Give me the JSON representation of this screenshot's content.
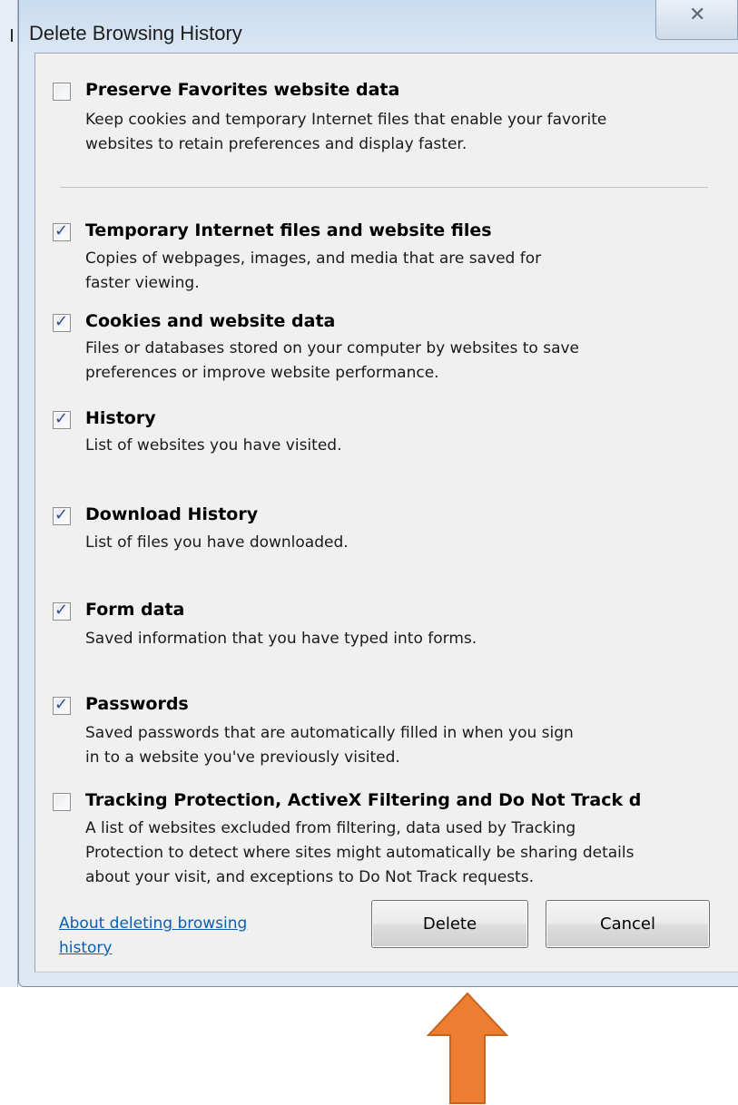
{
  "window": {
    "title": "Delete Browsing History",
    "close_icon": "close-icon",
    "close_glyph": "✕"
  },
  "options": [
    {
      "title": "Preserve Favorites website data",
      "description": "Keep cookies and temporary Internet files that enable your favorite\nwebsites to retain preferences and display faster.",
      "checked": false
    },
    {
      "title": "Temporary Internet files and website files",
      "description": "Copies of webpages, images, and media that are saved for\nfaster viewing.",
      "checked": true
    },
    {
      "title": "Cookies and website data",
      "description": "Files or databases stored on your computer by websites to save\npreferences or improve website performance.",
      "checked": true
    },
    {
      "title": "History",
      "description": "List of websites you have visited.",
      "checked": true
    },
    {
      "title": "Download History",
      "description": "List of files you have downloaded.",
      "checked": true
    },
    {
      "title": "Form data",
      "description": "Saved information that you have typed into forms.",
      "checked": true
    },
    {
      "title": "Passwords",
      "description": "Saved passwords that are automatically filled in when you sign\nin to a website you've previously visited.",
      "checked": true
    },
    {
      "title": "Tracking Protection, ActiveX Filtering and Do Not Track d",
      "description": "A list of websites excluded from filtering, data used by Tracking\nProtection to detect where sites might automatically be sharing details\nabout your visit, and exceptions to Do Not Track requests.",
      "checked": false
    }
  ],
  "checkmark_glyph": "✓",
  "footer": {
    "about_link": "About deleting browsing history",
    "delete_label": "Delete",
    "cancel_label": "Cancel"
  },
  "annotation": {
    "arrow_icon": "up-arrow-icon",
    "arrow_color": "#ed7d31"
  },
  "colors": {
    "link": "#0a5fb3",
    "check": "#2f4f8f"
  }
}
